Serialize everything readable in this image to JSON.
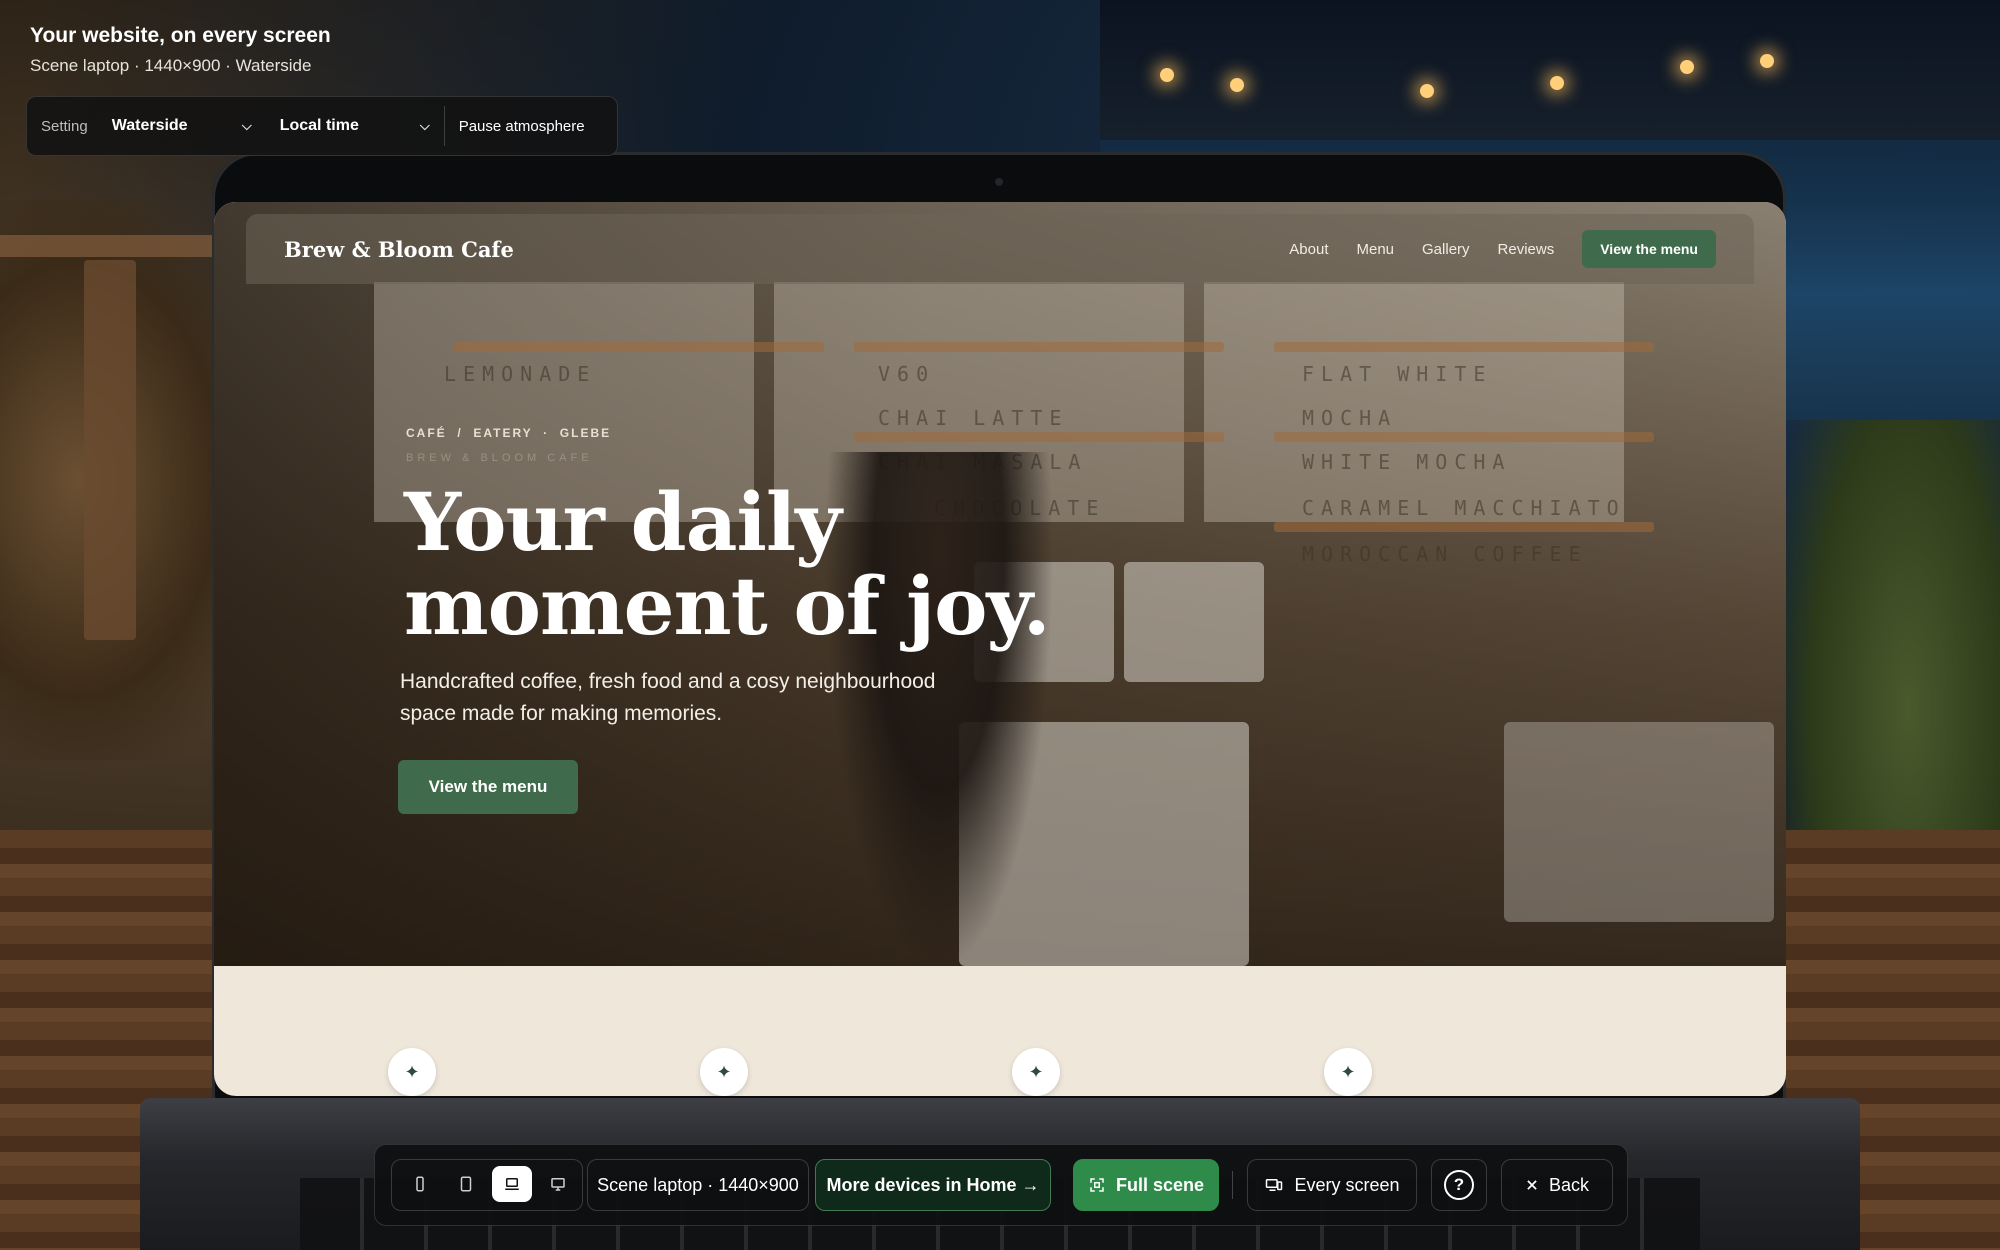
{
  "header": {
    "title": "Your website, on every screen",
    "subtitle": "Scene laptop · 1440×900 · Waterside"
  },
  "settings": {
    "label": "Setting",
    "setting_value": "Waterside",
    "time_value": "Local time",
    "pause_label": "Pause atmosphere"
  },
  "site": {
    "brand": "Brew & Bloom Cafe",
    "nav": [
      "About",
      "Menu",
      "Gallery",
      "Reviews"
    ],
    "nav_cta": "View the menu",
    "eyebrow": "CAFÉ  /  EATERY  ·  GLEBE",
    "eyebrow_faint": "BREW & BLOOM CAFE",
    "headline_line1": "Your daily",
    "headline_line2": "moment of joy.",
    "subheadline": "Handcrafted coffee, fresh food and a cosy neighbourhood space made for making memories.",
    "hero_cta": "View the menu",
    "menu_board": [
      "LEMONADE",
      "V60",
      "FLAT WHITE",
      "CHAI LATTE",
      "MOCHA",
      "CHAI MASALA",
      "WHITE MOCHA",
      "CHOCOLATE",
      "CARAMEL MACCHIATO",
      "MOROCCAN COFFEE"
    ],
    "sparkle": "✦"
  },
  "toolbar": {
    "devices": [
      "phone",
      "tablet",
      "laptop",
      "desktop"
    ],
    "active_device": "laptop",
    "scene_label": "Scene laptop · 1440×900",
    "more_devices": "More devices in Home →",
    "full_scene": "Full scene",
    "every_screen": "Every screen",
    "help": "?",
    "back": "Back"
  },
  "colors": {
    "brand_green": "#3f6b4c",
    "action_green": "#2f8b4a",
    "toolbar_bg": "#0e0f10"
  }
}
